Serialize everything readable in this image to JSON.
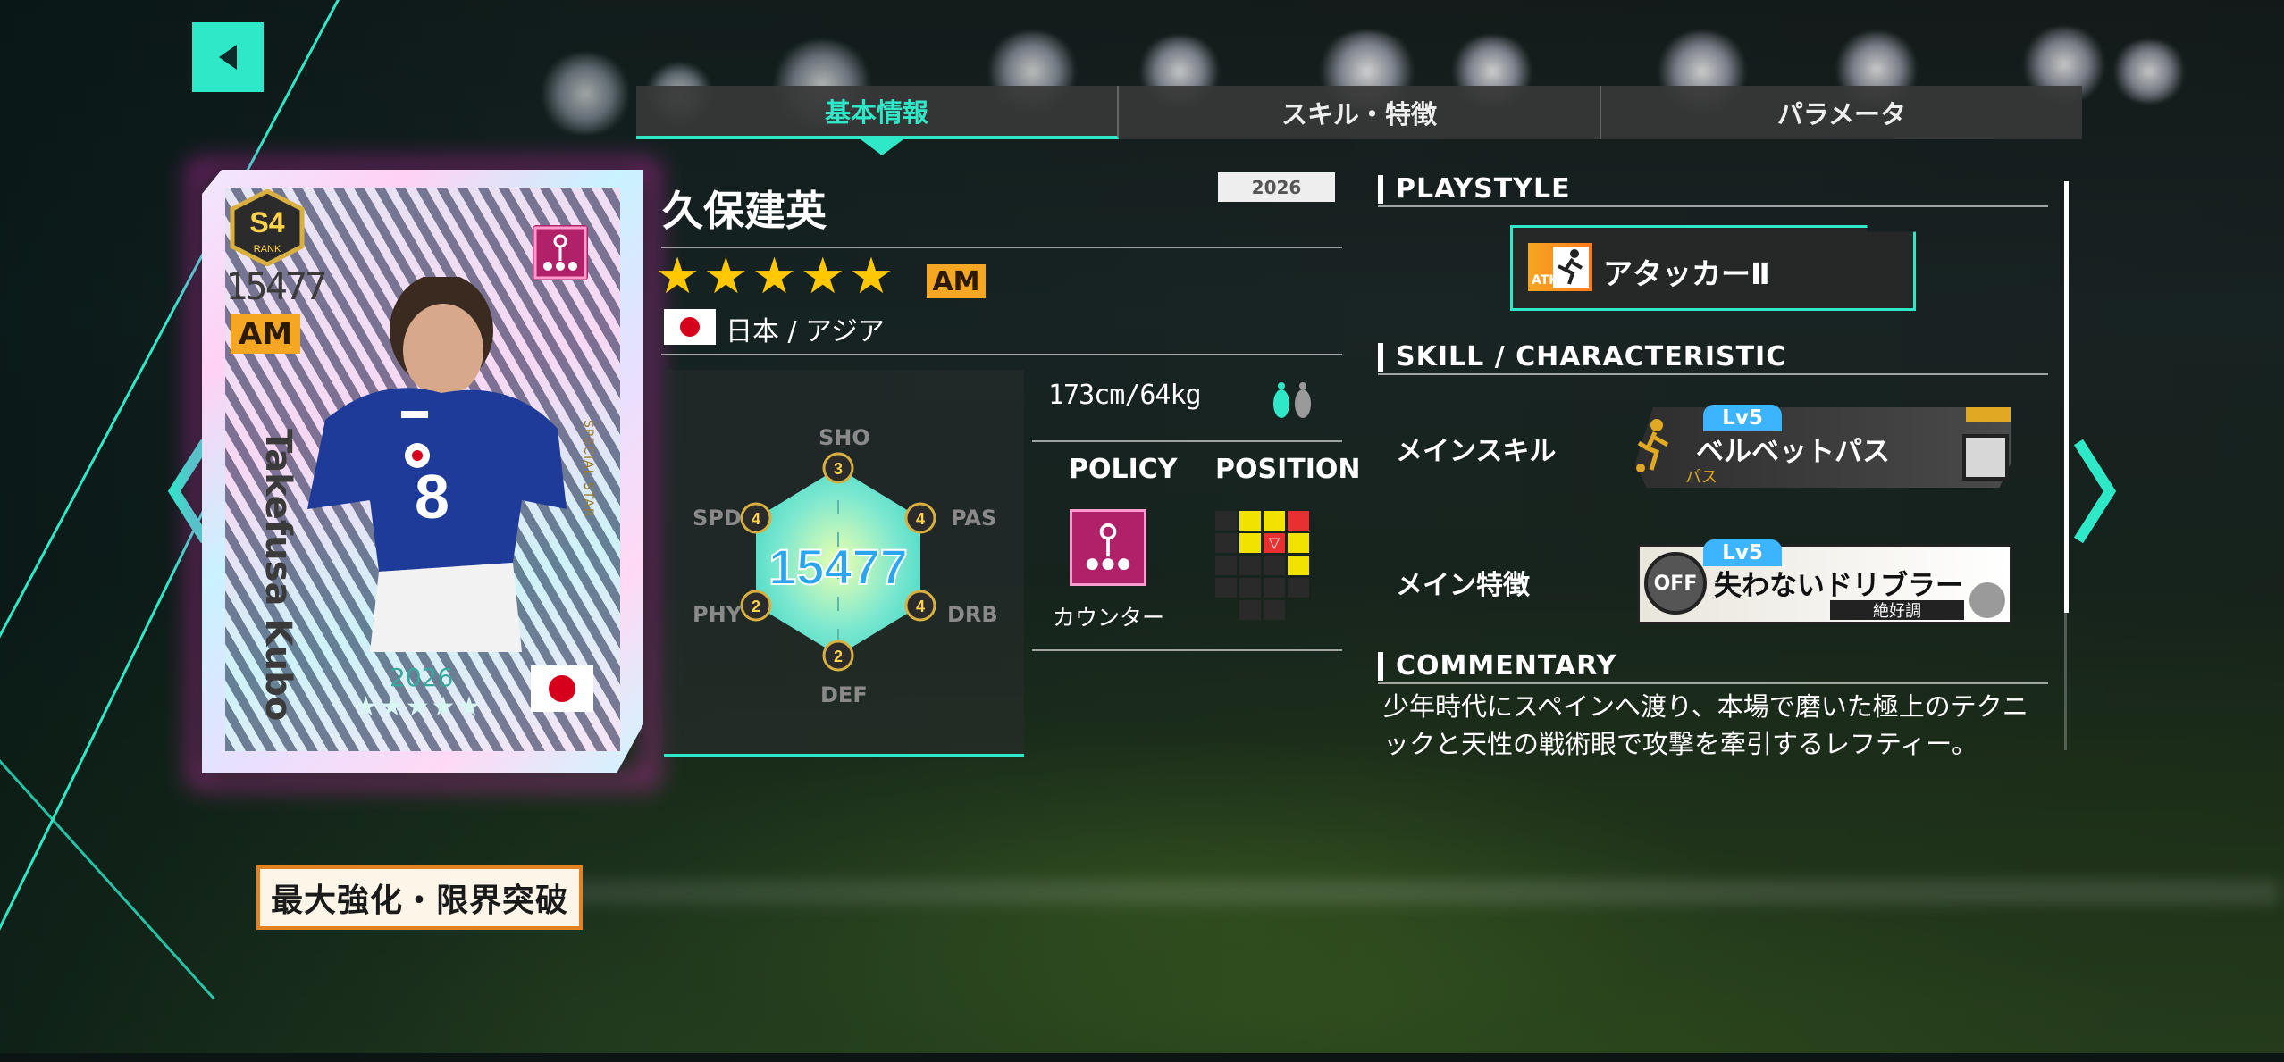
{
  "tabs": [
    {
      "label": "基本情報",
      "active": true
    },
    {
      "label": "スキル・特徴",
      "active": false
    },
    {
      "label": "パラメータ",
      "active": false
    }
  ],
  "card": {
    "rank": "S4",
    "rank_label": "RANK",
    "overall": "15477",
    "position": "AM",
    "name": "Takefusa Kubo",
    "year": "2026",
    "stars": "★★★★★",
    "special_text": "SPECIAL STAR",
    "shirt_number": "8"
  },
  "limit_break_button": "最大強化・限界突破",
  "player": {
    "name": "久保建英",
    "year": "2026",
    "stars": "★★★★★",
    "position": "AM",
    "nationality": "日本 / アジア",
    "body": "173cm/64kg"
  },
  "hex": {
    "overall": "15477",
    "labels": {
      "top": "SHO",
      "right_top": "PAS",
      "right_bottom": "DRB",
      "bottom": "DEF",
      "left_bottom": "PHY",
      "left_top": "SPD"
    },
    "ranks": {
      "SHO": "3",
      "PAS": "4",
      "DRB": "4",
      "DEF": "2",
      "PHY": "2",
      "SPD": "4"
    }
  },
  "policy": {
    "heading": "POLICY",
    "name": "カウンター"
  },
  "position_map": {
    "heading": "POSITION",
    "marker": "▽"
  },
  "playstyle": {
    "heading": "PLAYSTYLE",
    "tag": "ATK",
    "name": "アタッカーⅡ"
  },
  "skill_section": {
    "heading": "SKILL / CHARACTERISTIC",
    "main_skill_label": "メインスキル",
    "main_skill": {
      "level": "Lv5",
      "name": "ベルベットパス",
      "category": "パス"
    },
    "main_trait_label": "メイン特徴",
    "main_trait": {
      "level": "Lv5",
      "name": "失わないドリブラー",
      "condition": "絶好調",
      "status": "OFF"
    }
  },
  "commentary": {
    "heading": "COMMENTARY",
    "text": "少年時代にスペインへ渡り、本場で磨いた極上のテクニックと天性の戦術眼で攻撃を牽引するレフティー。"
  },
  "colors": {
    "accent": "#2ee8c8",
    "position_badge": "#f5a623",
    "star": "#ffc800",
    "policy": "#b0216a",
    "card_glow": "#ff2bd0"
  }
}
